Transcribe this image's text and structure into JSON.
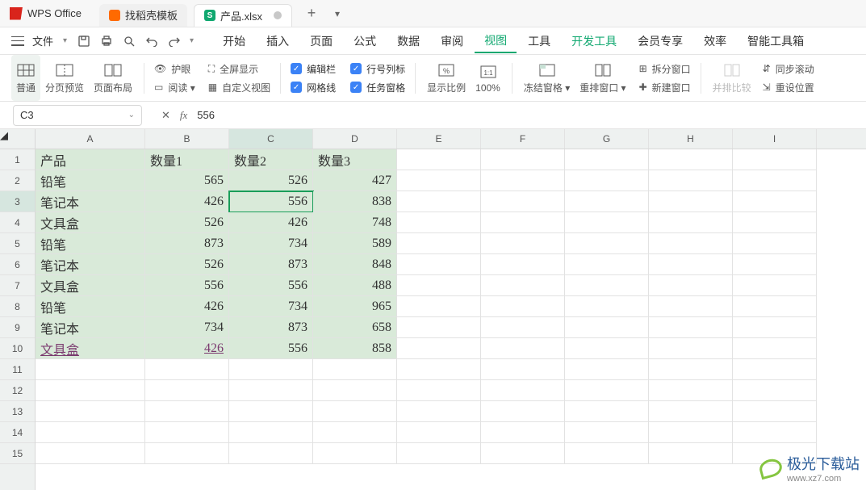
{
  "brand": "WPS Office",
  "tabs": [
    {
      "label": "找稻壳模板",
      "icon": "orange",
      "active": false
    },
    {
      "label": "产品.xlsx",
      "icon": "green",
      "active": true
    }
  ],
  "file_menu": "文件",
  "main_menu": [
    "开始",
    "插入",
    "页面",
    "公式",
    "数据",
    "审阅",
    "视图",
    "工具",
    "开发工具",
    "会员专享",
    "效率",
    "智能工具箱"
  ],
  "ribbon": {
    "views": [
      {
        "label": "普通"
      },
      {
        "label": "分页预览"
      },
      {
        "label": "页面布局"
      }
    ],
    "inline": [
      {
        "icon": "eye",
        "label": "护眼"
      },
      {
        "icon": "read",
        "label": "阅读 ▾"
      }
    ],
    "inline2": [
      {
        "icon": "full",
        "label": "全屏显示"
      },
      {
        "icon": "custom",
        "label": "自定义视图"
      }
    ],
    "checks": [
      {
        "label": "编辑栏"
      },
      {
        "label": "网格线"
      },
      {
        "label": "行号列标"
      },
      {
        "label": "任务窗格"
      }
    ],
    "zoom": [
      {
        "label": "显示比例"
      },
      {
        "label": "100%"
      }
    ],
    "freeze": {
      "label": "冻结窗格 ▾"
    },
    "arrange": {
      "label": "重排窗口 ▾"
    },
    "split": [
      {
        "label": "拆分窗口"
      },
      {
        "label": "新建窗口"
      }
    ],
    "compare": [
      {
        "label": "并排比较"
      },
      {
        "label": "同步滚动"
      },
      {
        "label": "重设位置"
      }
    ]
  },
  "namebox": {
    "cell": "C3",
    "fx": "556"
  },
  "cols": [
    "A",
    "B",
    "C",
    "D",
    "E",
    "F",
    "G",
    "H",
    "I"
  ],
  "rownums": [
    "1",
    "2",
    "3",
    "4",
    "5",
    "6",
    "7",
    "8",
    "9",
    "10",
    "11",
    "12",
    "13",
    "14",
    "15"
  ],
  "header_row": [
    "产品",
    "数量1",
    "数量2",
    "数量3"
  ],
  "data_rows": [
    {
      "a": "铅笔",
      "b": "565",
      "c": "526",
      "d": "427"
    },
    {
      "a": "笔记本",
      "b": "426",
      "c": "556",
      "d": "838"
    },
    {
      "a": "文具盒",
      "b": "526",
      "c": "426",
      "d": "748"
    },
    {
      "a": "铅笔",
      "b": "873",
      "c": "734",
      "d": "589"
    },
    {
      "a": "笔记本",
      "b": "526",
      "c": "873",
      "d": "848"
    },
    {
      "a": "文具盒",
      "b": "556",
      "c": "556",
      "d": "488"
    },
    {
      "a": "铅笔",
      "b": "426",
      "c": "734",
      "d": "965"
    },
    {
      "a": "笔记本",
      "b": "734",
      "c": "873",
      "d": "658"
    },
    {
      "a": "文具盒",
      "b": "426",
      "c": "556",
      "d": "858"
    }
  ],
  "watermark": {
    "text": "极光下载站",
    "url": "www.xz7.com"
  }
}
